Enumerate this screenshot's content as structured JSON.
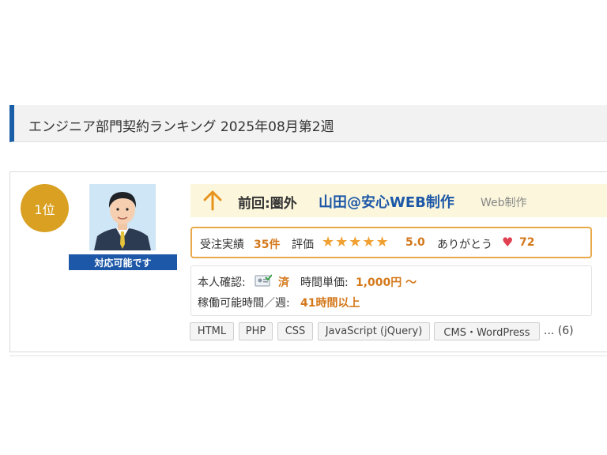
{
  "section": {
    "title": "エンジニア部門契約ランキング 2025年08月第2週"
  },
  "ranking": {
    "rank_label": "1位",
    "availability_label": "対応可能です",
    "prev_rank_label": "前回:圏外",
    "user_name": "山田@安心WEB制作",
    "category": "Web制作",
    "orders_label": "受注実績",
    "orders_value": "35件",
    "rating_label": "評価",
    "stars": "★★★★★",
    "rating_value": "5.0",
    "thanks_label": "ありがとう",
    "thanks_value": "72",
    "identity_label": "本人確認:",
    "identity_value": "済",
    "hourly_label": "時間単価:",
    "hourly_value": "1,000円 〜",
    "hours_label": "稼働可能時間／週:",
    "hours_value": "41時間以上",
    "tags": [
      "HTML",
      "PHP",
      "CSS",
      "JavaScript (jQuery)",
      "CMS・WordPress"
    ],
    "more_tags": "... (6)"
  },
  "colors": {
    "accent_blue": "#1d58a8",
    "badge_gold": "#d9a022",
    "orange": "#d4791c",
    "star": "#f0a030",
    "heart": "#e04050"
  },
  "icons": [
    "arrow-up-icon",
    "star-icon",
    "heart-icon",
    "id-verified-icon"
  ]
}
